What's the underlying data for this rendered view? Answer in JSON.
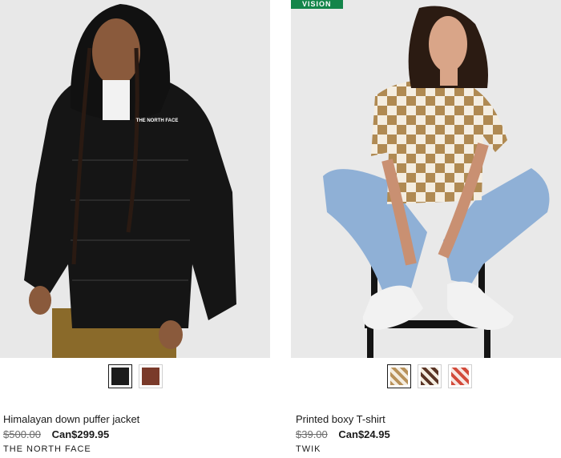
{
  "products": [
    {
      "name": "Himalayan down puffer jacket",
      "old_price": "$500.00",
      "new_price": "Can$299.95",
      "brand": "THE NORTH FACE",
      "logo_text": "THE NORTH FACE",
      "swatch_colors": [
        "#1c1c1c",
        "#7a3a2a"
      ]
    },
    {
      "badge": "VISION",
      "name": "Printed boxy T-shirt",
      "old_price": "$39.00",
      "new_price": "Can$24.95",
      "brand": "TWIK",
      "swatch_colors": [
        "#b8915a",
        "#5a3425",
        "#d24a3a"
      ]
    }
  ]
}
